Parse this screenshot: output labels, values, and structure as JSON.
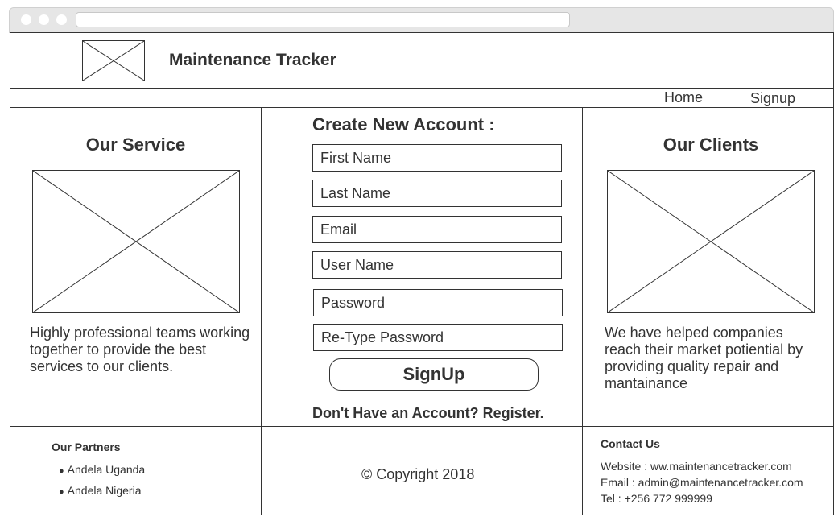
{
  "header": {
    "title": "Maintenance Tracker"
  },
  "nav": {
    "items": [
      "Home",
      "Signup"
    ]
  },
  "service": {
    "heading": "Our Service",
    "text": "Highly professional teams working together to provide the best services to our clients."
  },
  "form": {
    "heading": "Create New Account :",
    "fields": [
      "First Name",
      "Last Name",
      "Email",
      "User Name",
      "Password",
      "Re-Type Password"
    ],
    "submit_label": "SignUp",
    "register_text": "Don't Have an Account? Register."
  },
  "clients": {
    "heading": "Our Clients",
    "text": "We have helped companies reach their market potiential by providing quality repair and mantainance"
  },
  "footer": {
    "partners_heading": "Our Partners",
    "partners": [
      "Andela Uganda",
      "Andela Nigeria"
    ],
    "copyright": "© Copyright 2018",
    "contact_heading": "Contact Us",
    "contact_lines": [
      "Website : ww.maintenancetracker.com",
      "Email : admin@maintenancetracker.com",
      "Tel : +256 772 999999"
    ]
  },
  "icons": {
    "logo": "image-placeholder-icon",
    "service_image": "image-placeholder-icon",
    "clients_image": "image-placeholder-icon"
  }
}
